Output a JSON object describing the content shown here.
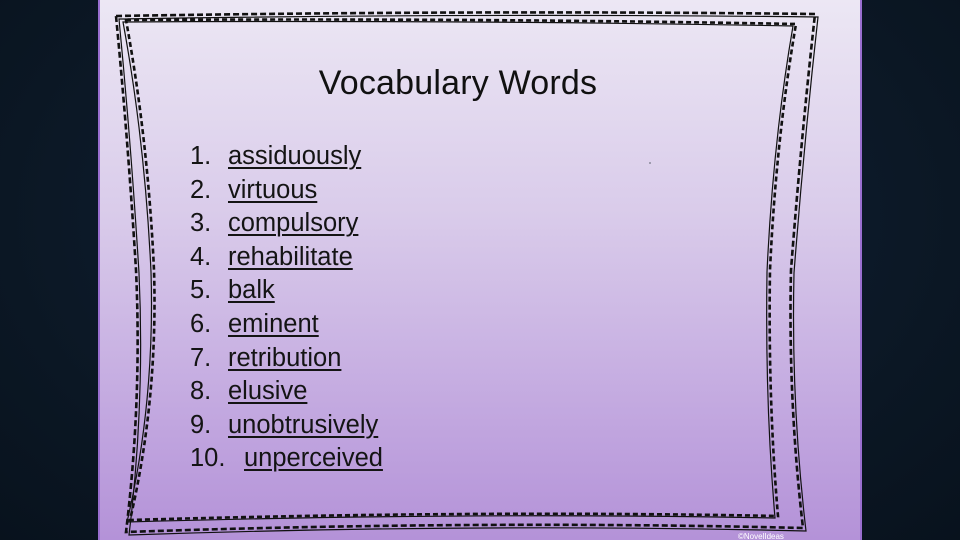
{
  "slide": {
    "title": "Vocabulary Words",
    "items": [
      {
        "number": "1.",
        "word": "assiduously"
      },
      {
        "number": "2.",
        "word": "virtuous"
      },
      {
        "number": "3.",
        "word": "compulsory"
      },
      {
        "number": "4.",
        "word": "rehabilitate"
      },
      {
        "number": "5.",
        "word": "balk"
      },
      {
        "number": "6.",
        "word": "eminent"
      },
      {
        "number": "7.",
        "word": "retribution"
      },
      {
        "number": "8.",
        "word": "elusive"
      },
      {
        "number": "9.",
        "word": "unobtrusively"
      },
      {
        "number": "10.",
        "word": "unperceived"
      }
    ],
    "watermark": "©NovelIdeas",
    "colors": {
      "background": "#0d1a28",
      "slide_top": "#ece7f4",
      "slide_bottom": "#b492d8",
      "slide_edge": "#9a6fd0",
      "text": "#141414"
    }
  }
}
